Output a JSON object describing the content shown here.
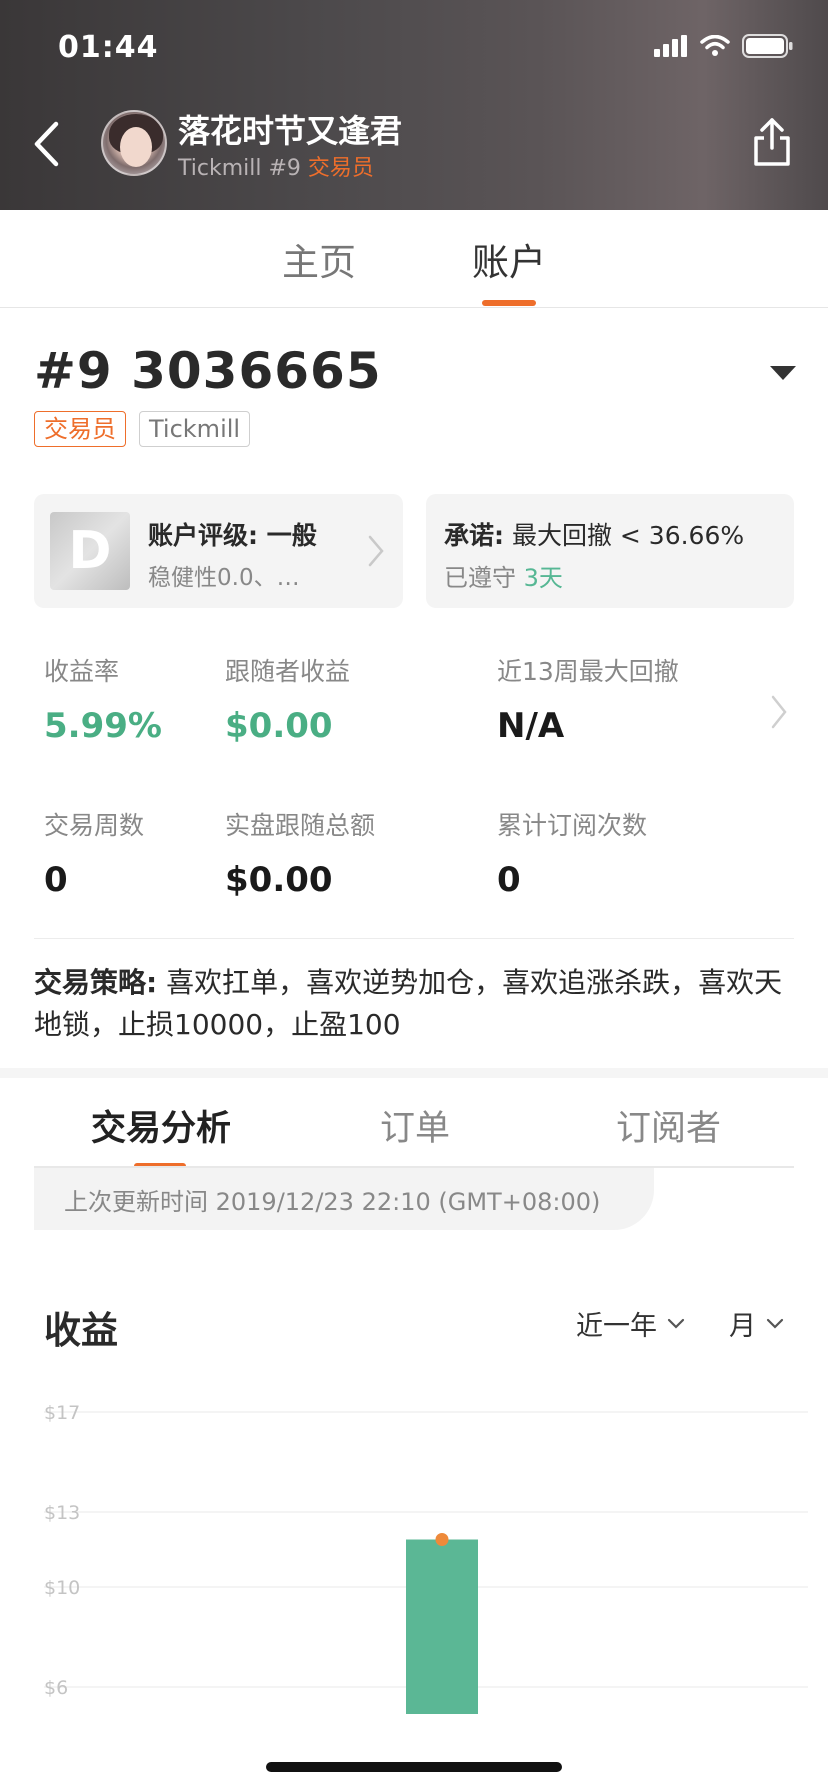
{
  "status_bar": {
    "time": "01:44"
  },
  "header": {
    "name": "落花时节又逢君",
    "broker_line": "Tickmill #9",
    "role": "交易员"
  },
  "main_tabs": [
    {
      "label": "主页",
      "active": false
    },
    {
      "label": "账户",
      "active": true
    }
  ],
  "account": {
    "number": "#9 3036665",
    "role_badge": "交易员",
    "broker_badge": "Tickmill"
  },
  "rating_card": {
    "grade": "D",
    "title": "账户评级: 一般",
    "subtitle": "稳健性0.0、…"
  },
  "promise_card": {
    "title_label": "承诺:",
    "title_value": "最大回撤 < 36.66%",
    "kept_label": "已遵守",
    "kept_days": "3天"
  },
  "stats": [
    {
      "label": "收益率",
      "value": "5.99%",
      "green": true
    },
    {
      "label": "跟随者收益",
      "value": "$0.00",
      "green": true
    },
    {
      "label": "近13周最大回撤",
      "value": "N/A",
      "green": false
    },
    {
      "label": "交易周数",
      "value": "0",
      "green": false
    },
    {
      "label": "实盘跟随总额",
      "value": "$0.00",
      "green": false
    },
    {
      "label": "累计订阅次数",
      "value": "0",
      "green": false
    }
  ],
  "strategy": {
    "label": "交易策略:",
    "text": " 喜欢扛单，喜欢逆势加仓，喜欢追涨杀跌，喜欢天地锁，止损10000，止盈100"
  },
  "sub_tabs": [
    {
      "label": "交易分析",
      "active": true
    },
    {
      "label": "订单",
      "active": false
    },
    {
      "label": "订阅者",
      "active": false
    }
  ],
  "update_text": "上次更新时间 2019/12/23 22:10 (GMT+08:00)",
  "earnings": {
    "title": "收益",
    "period_filter": "近一年",
    "interval_filter": "月"
  },
  "chart_data": {
    "type": "bar",
    "title": "收益",
    "y_ticks": [
      "$17",
      "$13",
      "$10",
      "$6"
    ],
    "y_tick_values": [
      17,
      13,
      10,
      6
    ],
    "ylim": [
      5,
      17
    ],
    "categories": [
      ""
    ],
    "values": [
      11.9
    ],
    "bar_color": "#5bb795",
    "marker_color": "#ee8a3a",
    "grid": true
  },
  "colors": {
    "accent": "#ee6e2b",
    "positive": "#4aae84"
  }
}
